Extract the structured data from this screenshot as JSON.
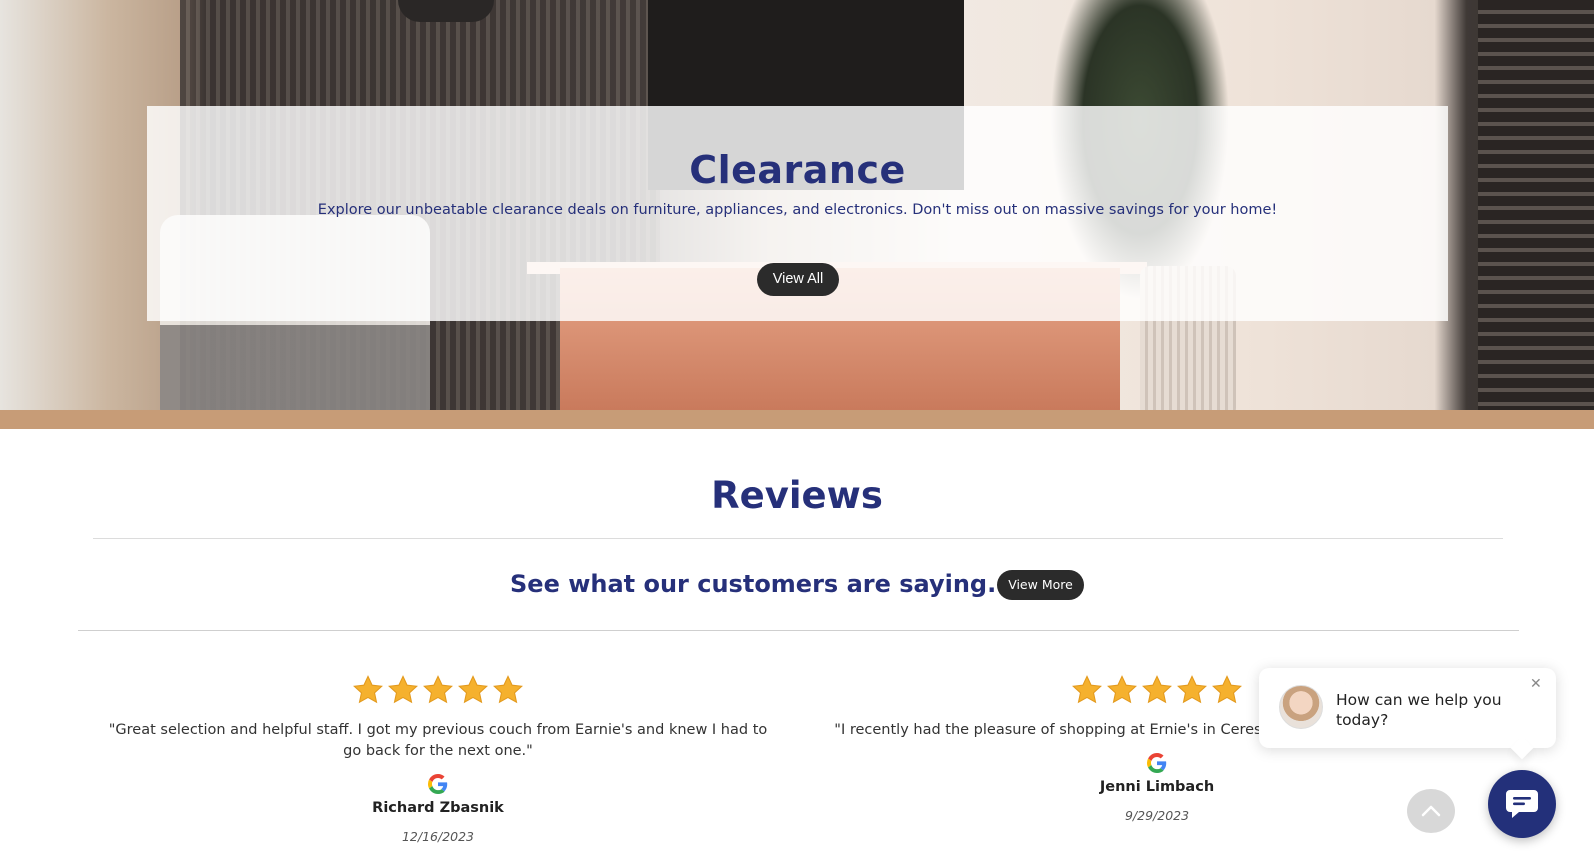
{
  "banner": {
    "title": "Clearance",
    "description": "Explore our unbeatable clearance deals on furniture, appliances, and electronics. Don't miss out on massive savings for your home!",
    "button_label": "View All"
  },
  "reviews": {
    "title": "Reviews",
    "tagline": "See what our customers are saying...",
    "view_more_label": "View More",
    "items": [
      {
        "rating": 5,
        "text": "\"Great selection and helpful staff. I got my previous couch from Earnie's and knew I had to go back for the next one.\"",
        "source_icon": "google-icon",
        "name": "Richard Zbasnik",
        "date": "12/16/2023"
      },
      {
        "rating": 5,
        "text": "\"I recently had the pleasure of shopping at Ernie's in Ceresco, I am with my experience!\"",
        "source_icon": "google-icon",
        "name": "Jenni Limbach",
        "date": "9/29/2023"
      }
    ]
  },
  "chat": {
    "prompt": "How can we help you today?",
    "close_icon": "close-icon",
    "launcher_icon": "chat-icon"
  },
  "scroll_top_icon": "chevron-up-icon",
  "colors": {
    "brand_navy": "#26307a",
    "button_dark": "#2b2b2b",
    "star_gold": "#f5b12e"
  }
}
